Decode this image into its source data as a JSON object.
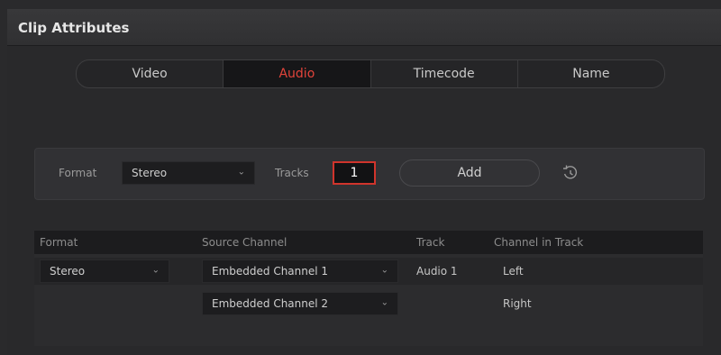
{
  "window": {
    "title": "Clip Attributes"
  },
  "tabs": [
    {
      "label": "Video"
    },
    {
      "label": "Audio",
      "active": true
    },
    {
      "label": "Timecode"
    },
    {
      "label": "Name"
    }
  ],
  "format_bar": {
    "format_label": "Format",
    "format_value": "Stereo",
    "tracks_label": "Tracks",
    "tracks_value": "1",
    "add_label": "Add"
  },
  "table": {
    "headers": [
      "Format",
      "Source Channel",
      "Track",
      "Channel in Track"
    ],
    "rows": [
      {
        "format": "Stereo",
        "source_channel": "Embedded Channel 1",
        "track": "Audio 1",
        "channel_in_track": "Left"
      },
      {
        "format": "",
        "source_channel": "Embedded Channel 2",
        "track": "",
        "channel_in_track": "Right"
      }
    ]
  },
  "colors": {
    "accent": "#e2443b",
    "background": "#29292b"
  }
}
